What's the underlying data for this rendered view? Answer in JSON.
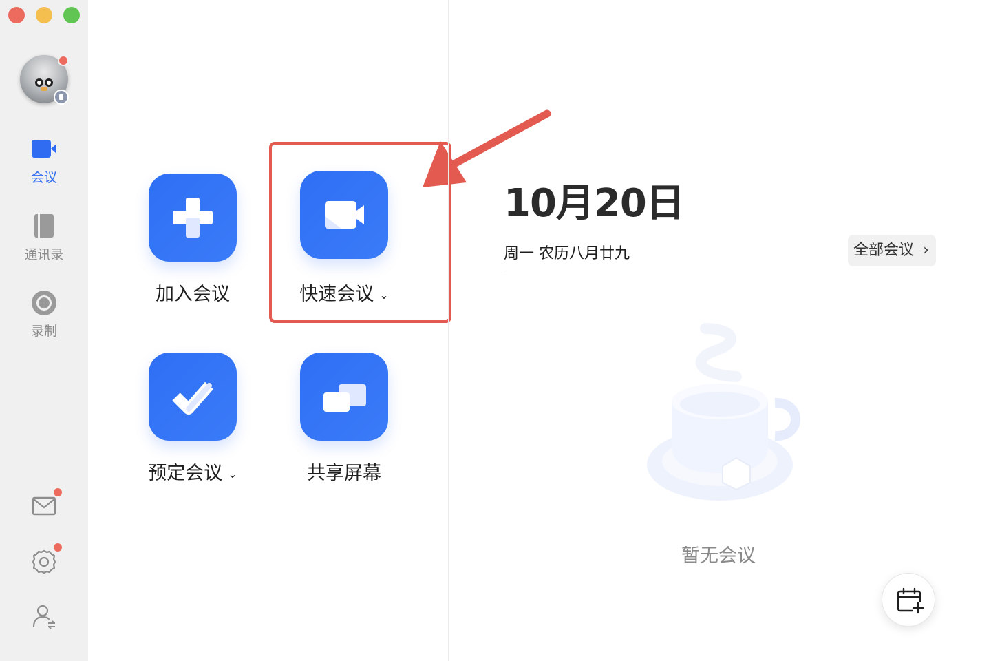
{
  "window": {
    "controls": [
      "close",
      "minimize",
      "maximize"
    ]
  },
  "sidebar": {
    "avatar": {
      "has_notification_dot": true
    },
    "items": [
      {
        "id": "meetings",
        "label": "会议",
        "icon": "video-camera-icon",
        "active": true
      },
      {
        "id": "contacts",
        "label": "通讯录",
        "icon": "address-book-icon",
        "active": false
      },
      {
        "id": "record",
        "label": "录制",
        "icon": "record-icon",
        "active": false
      }
    ],
    "bottom_icons": [
      {
        "id": "mail",
        "icon": "mail-icon",
        "has_notification_dot": true
      },
      {
        "id": "settings",
        "icon": "gear-icon",
        "has_notification_dot": true
      },
      {
        "id": "account-switch",
        "icon": "user-switch-icon",
        "has_notification_dot": false
      }
    ]
  },
  "actions": {
    "join": {
      "label": "加入会议",
      "icon": "plus-icon"
    },
    "quick": {
      "label": "快速会议",
      "icon": "video-camera-icon",
      "has_dropdown": true
    },
    "schedule": {
      "label": "预定会议",
      "icon": "checkmark-icon",
      "has_dropdown": true
    },
    "share": {
      "label": "共享屏幕",
      "icon": "share-screen-icon"
    }
  },
  "right_panel": {
    "date": "10月20日",
    "subdate": "周一 农历八月廿九",
    "all_meetings_button": "全部会议",
    "empty_text": "暂无会议"
  },
  "colors": {
    "accent": "#2F6CF2",
    "highlight": "#E25A50",
    "sidebar_bg": "#F0F0F0"
  }
}
